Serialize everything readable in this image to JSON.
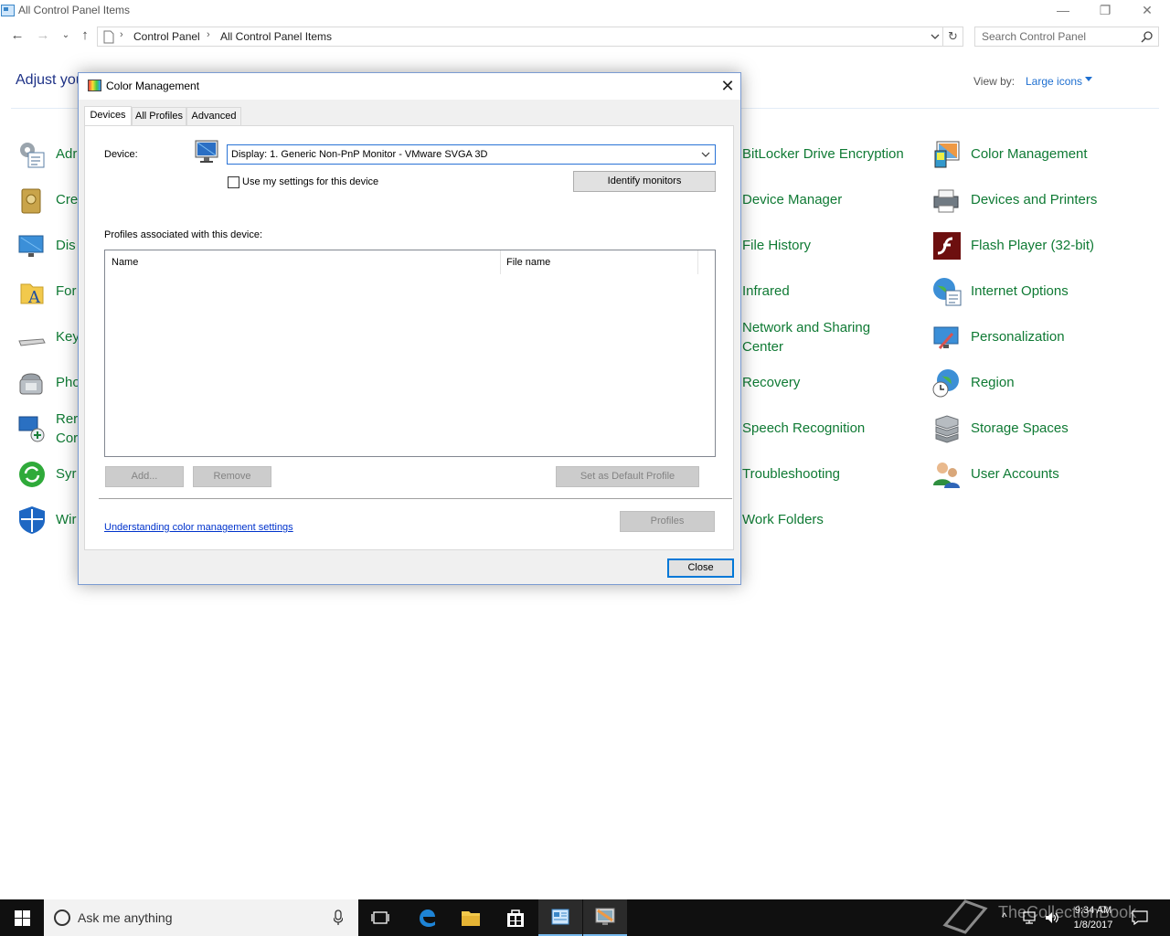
{
  "window": {
    "title": "All Control Panel Items",
    "minimize_glyph": "—",
    "restore_glyph": "❐",
    "close_glyph": "✕"
  },
  "address": {
    "breadcrumbs": [
      "Control Panel",
      "All Control Panel Items"
    ],
    "search_placeholder": "Search Control Panel"
  },
  "page": {
    "heading_visible": "Adjust you",
    "view_by_label": "View by:",
    "view_by_value": "Large icons"
  },
  "control_panel_items": {
    "left_partial": [
      "Adr",
      "Cre",
      "Dis",
      "For",
      "Key",
      "Pho",
      "Rer\nCor",
      "Syr",
      "Wir"
    ],
    "column3": [
      "BitLocker Drive Encryption",
      "Device Manager",
      "File History",
      "Infrared",
      "Network and Sharing\nCenter",
      "Recovery",
      "Speech Recognition",
      "Troubleshooting",
      "Work Folders"
    ],
    "column4": [
      "Color Management",
      "Devices and Printers",
      "Flash Player (32-bit)",
      "Internet Options",
      "Personalization",
      "Region",
      "Storage Spaces",
      "User Accounts"
    ]
  },
  "dialog": {
    "title": "Color Management",
    "tabs": [
      "Devices",
      "All Profiles",
      "Advanced"
    ],
    "active_tab": "Devices",
    "device_label": "Device:",
    "device_value": "Display: 1. Generic Non-PnP Monitor - VMware SVGA 3D",
    "use_my_settings_label": "Use my settings for this device",
    "use_my_settings_checked": false,
    "identify_button": "Identify monitors",
    "profiles_label": "Profiles associated with this device:",
    "table_headers": [
      "Name",
      "File name"
    ],
    "add_button": "Add...",
    "remove_button": "Remove",
    "set_default_button": "Set as Default Profile",
    "profiles_button": "Profiles",
    "help_link": "Understanding color management settings",
    "close_button": "Close"
  },
  "taskbar": {
    "search_text": "Ask me anything",
    "time": "9:34 AM",
    "date": "1/8/2017",
    "watermark": "TheCollectionBook"
  },
  "colors": {
    "link_green": "#0f7a34",
    "heading_blue": "#1e3287",
    "accent_blue": "#0078d7"
  }
}
